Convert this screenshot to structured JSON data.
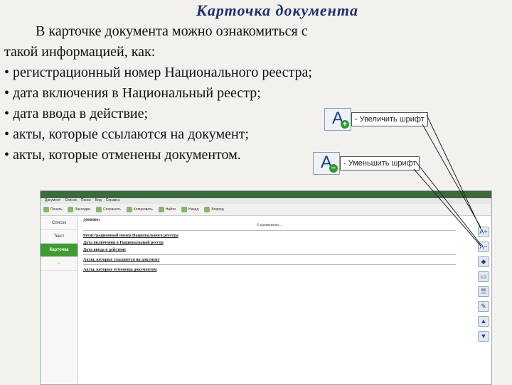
{
  "slide": {
    "title": "Карточка документа",
    "intro": "В карточке документа можно ознакомиться с такой информацией, как:",
    "bullets": [
      "• регистрационный номер Национального реестра;",
      "• дата включения в Национальный реестр;",
      "• дата ввода в действие;",
      "• акты, которые ссылаются на документ;",
      "• акты, которые отменены документом."
    ]
  },
  "callouts": {
    "increase": {
      "glyph": "A",
      "sign": "+",
      "label": "- Увеличить шрифт",
      "sign_color": "#2f9a2f"
    },
    "decrease": {
      "glyph": "A",
      "sign": "−",
      "label": "- Уменьшить шрифт",
      "sign_color": "#2f9a2f"
    }
  },
  "screenshot": {
    "menu": [
      "Документ",
      "Список",
      "Поиск",
      "Вид",
      "Справка"
    ],
    "toolbar": [
      "Печать",
      "Закладки",
      "Сохранить",
      "Копировать",
      "Найти",
      "Назад",
      "Вперед"
    ],
    "nav": [
      {
        "label": "Список",
        "active": false
      },
      {
        "label": "Текст",
        "active": false
      },
      {
        "label": "Карточка",
        "active": true
      },
      {
        "label": "...",
        "active": false
      }
    ],
    "doc": {
      "link": "Д09800001",
      "heading": "О применении ...",
      "sections": [
        "Регистрационный номер Национального реестра",
        "Дата включения в Национальный реестр",
        "Дата ввода в действие",
        "Акты, которые ссылаются на документ",
        "Акты, которые отменены документом"
      ]
    },
    "right_tools": [
      "A+",
      "A−",
      "◆",
      "▭",
      "☰",
      "✎",
      "▲",
      "▼"
    ]
  },
  "colors": {
    "title": "#1f2f6e",
    "accent_green": "#3f9b2f"
  }
}
